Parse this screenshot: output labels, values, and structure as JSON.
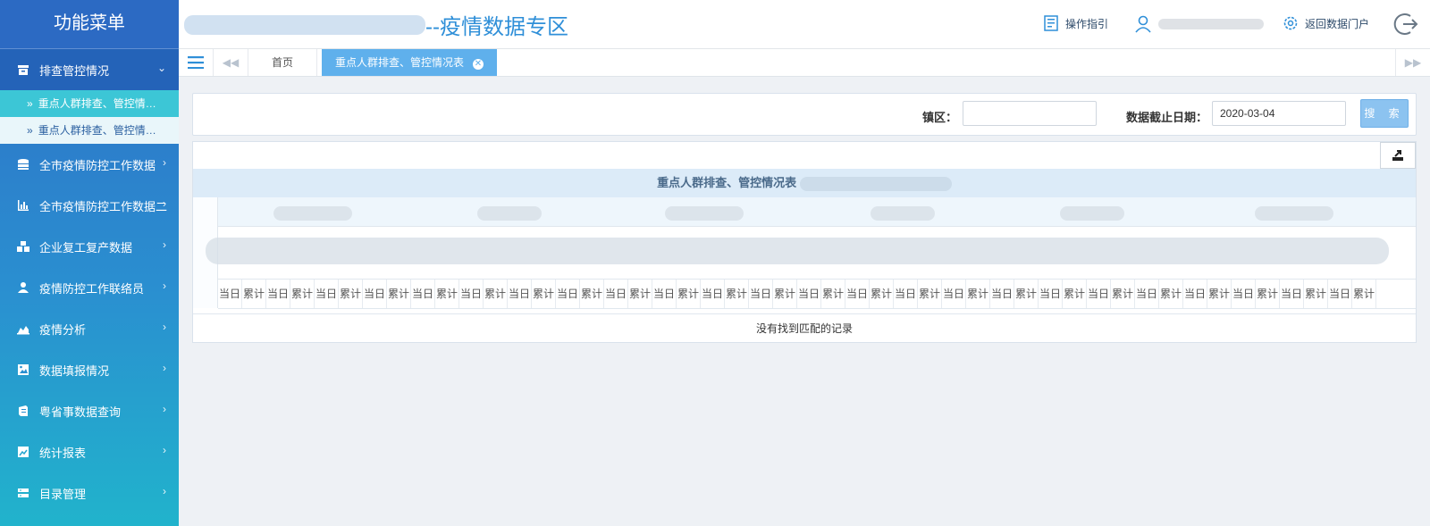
{
  "sidebar": {
    "title": "功能菜单",
    "groups": [
      {
        "label": "排查管控情况",
        "icon": "box-icon",
        "expanded": true,
        "children": [
          {
            "label": "重点人群排查、管控情…"
          },
          {
            "label": "重点人群排查、管控情…"
          }
        ]
      },
      {
        "label": "全市疫情防控工作数据",
        "icon": "database-icon"
      },
      {
        "label": "全市疫情防控工作数据二",
        "icon": "bar-chart-icon"
      },
      {
        "label": "企业复工复产数据",
        "icon": "cubes-icon"
      },
      {
        "label": "疫情防控工作联络员",
        "icon": "user-icon"
      },
      {
        "label": "疫情分析",
        "icon": "area-chart-icon"
      },
      {
        "label": "数据填报情况",
        "icon": "image-icon"
      },
      {
        "label": "粤省事数据查询",
        "icon": "book-icon"
      },
      {
        "label": "统计报表",
        "icon": "report-icon"
      },
      {
        "label": "目录管理",
        "icon": "server-icon"
      }
    ]
  },
  "header": {
    "title_suffix": "--疫情数据专区",
    "guide_label": "操作指引",
    "return_label": "返回数据门户"
  },
  "tabs": {
    "home_label": "首页",
    "active_label": "重点人群排查、管控情况表"
  },
  "search": {
    "district_label": "镇区：",
    "district_value": "",
    "date_label": "数据截止日期：",
    "date_value": "2020-03-04",
    "search_button": "搜 索"
  },
  "table": {
    "title": "重点人群排查、管控情况表",
    "sub_labels": [
      "当日",
      "累计"
    ],
    "sub_pairs": 24,
    "empty_text": "没有找到匹配的记录"
  },
  "colors": {
    "accent": "#2f8fd8",
    "sidebar_top": "#2f6fc6",
    "sidebar_bottom": "#21b3cc",
    "active_tab": "#5fb0ec"
  }
}
